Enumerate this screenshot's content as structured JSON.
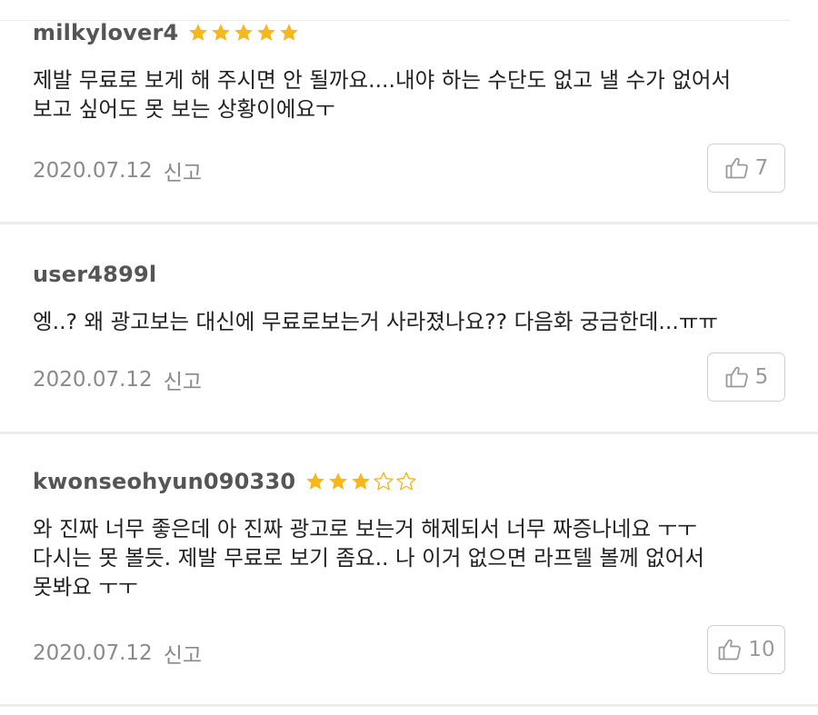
{
  "reviews": [
    {
      "username": "milkylover4",
      "rating": 5,
      "lines": [
        "제발 무료로 보게 해 주시면 안 될까요....내야 하는 수단도 없고 낼 수가 없어서",
        "보고 싶어도 못 보는 상황이에요ㅜ"
      ],
      "date": "2020.07.12",
      "report_label": "신고",
      "likes": "7"
    },
    {
      "username": "user4899l",
      "rating": 0,
      "lines": [
        "엥..? 왜 광고보는 대신에 무료로보는거 사라졌나요?? 다음화 궁금한데...ㅠㅠ"
      ],
      "date": "2020.07.12",
      "report_label": "신고",
      "likes": "5"
    },
    {
      "username": "kwonseohyun090330",
      "rating": 3,
      "lines": [
        "와 진짜 너무 좋은데 아 진짜 광고로 보는거 해제되서 너무 짜증나네요 ㅜㅜ",
        "다시는 못 볼듯. 제발 무료로 보기 좀요.. 나 이거 없으면 라프텔 볼께 없어서",
        "못봐요 ㅜㅜ"
      ],
      "date": "2020.07.12",
      "report_label": "신고",
      "likes": "10"
    }
  ],
  "colors": {
    "star_filled": "#f6b71a",
    "star_empty": "#f6b71a",
    "divider": "#ececec"
  },
  "icons": {
    "star": "star-icon",
    "like": "thumbs-up-icon"
  }
}
